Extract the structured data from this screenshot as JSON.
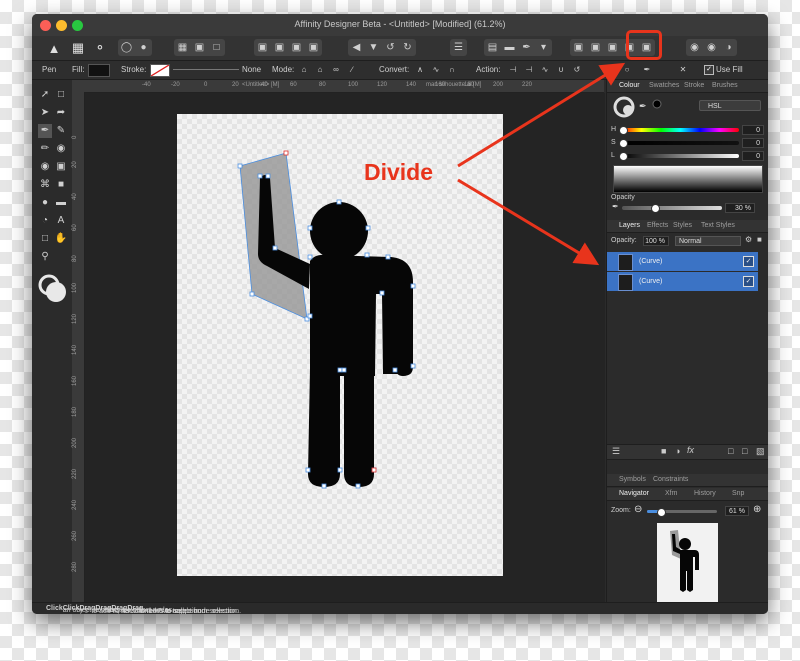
{
  "window": {
    "title": "Affinity Designer Beta - <Untitled> [Modified] (61.2%)"
  },
  "toolbar": {
    "groups": [
      "persona",
      "view-mode",
      "snapping",
      "arrange",
      "geometry",
      "boolean",
      "misc"
    ],
    "highlighted_button_icon": "divide-icon"
  },
  "context_toolbar": {
    "tool_name": "Pen",
    "fill_label": "Fill:",
    "stroke_label": "Stroke:",
    "stroke_width_value": "None",
    "mode_label": "Mode:",
    "convert_label": "Convert:",
    "action_label": "Action:",
    "use_fill_label": "Use Fill",
    "use_fill_checked": true
  },
  "document": {
    "tab_left": "<Untitled> [M]",
    "tab_right": "man silhouette.ai [M]",
    "ruler_top_ticks": [
      "-40",
      "-20",
      "0",
      "20",
      "40",
      "60",
      "80",
      "100",
      "120",
      "140",
      "160",
      "180",
      "200",
      "220"
    ],
    "ruler_left_ticks": [
      "0",
      "20",
      "40",
      "60",
      "80",
      "100",
      "120",
      "140",
      "160",
      "180",
      "200",
      "220",
      "240",
      "260",
      "280"
    ]
  },
  "annotation": {
    "label": "Divide",
    "color": "#e8341c"
  },
  "colour_panel": {
    "tabs": [
      "Colour",
      "Swatches",
      "Stroke",
      "Brushes"
    ],
    "active_tab": "Colour",
    "model": "HSL",
    "sliders": [
      {
        "label": "H",
        "value": "0"
      },
      {
        "label": "S",
        "value": "0"
      },
      {
        "label": "L",
        "value": "0"
      }
    ],
    "opacity_label": "Opacity",
    "opacity_value": "30 %"
  },
  "layers_panel": {
    "tabs": [
      "Layers",
      "Effects",
      "Styles",
      "Text Styles"
    ],
    "active_tab": "Layers",
    "opacity_label": "Opacity:",
    "opacity_value": "100 %",
    "blend_mode": "Normal",
    "layers": [
      {
        "name": "(Curve)",
        "visible": true
      },
      {
        "name": "(Curve)",
        "visible": true
      }
    ]
  },
  "symbols_panel": {
    "tabs": [
      "Symbols",
      "Constraints"
    ]
  },
  "navigator_panel": {
    "tabs": [
      "Navigator",
      "Xfm",
      "History",
      "Snp"
    ],
    "active_tab": "Navigator",
    "zoom_label": "Zoom:",
    "zoom_value": "61 %",
    "zoom_fraction": 0.2
  },
  "status_bar": {
    "parts": [
      {
        "text": "Click",
        "bold": true
      },
      {
        "text": " an object to select it. ",
        "bold": false
      },
      {
        "text": "Click",
        "bold": true
      },
      {
        "text": "+⇧ to add to selection. ",
        "bold": false
      },
      {
        "text": "Drag",
        "bold": true
      },
      {
        "text": " to marquee select nodes. ",
        "bold": false
      },
      {
        "text": "Drag",
        "bold": true
      },
      {
        "text": "+⇧ to add nodes to selection. ",
        "bold": false
      },
      {
        "text": "Drag",
        "bold": true
      },
      {
        "text": "+⌃ to remove nodes from selection. ",
        "bold": false
      },
      {
        "text": "Drag",
        "bold": true
      },
      {
        "text": "+⇧+⌃ to toggle node selection.",
        "bold": false
      }
    ]
  },
  "colors": {
    "accent_red": "#e8341c",
    "selection_blue": "#3b73c5",
    "app_bg": "#2b2b2b"
  }
}
